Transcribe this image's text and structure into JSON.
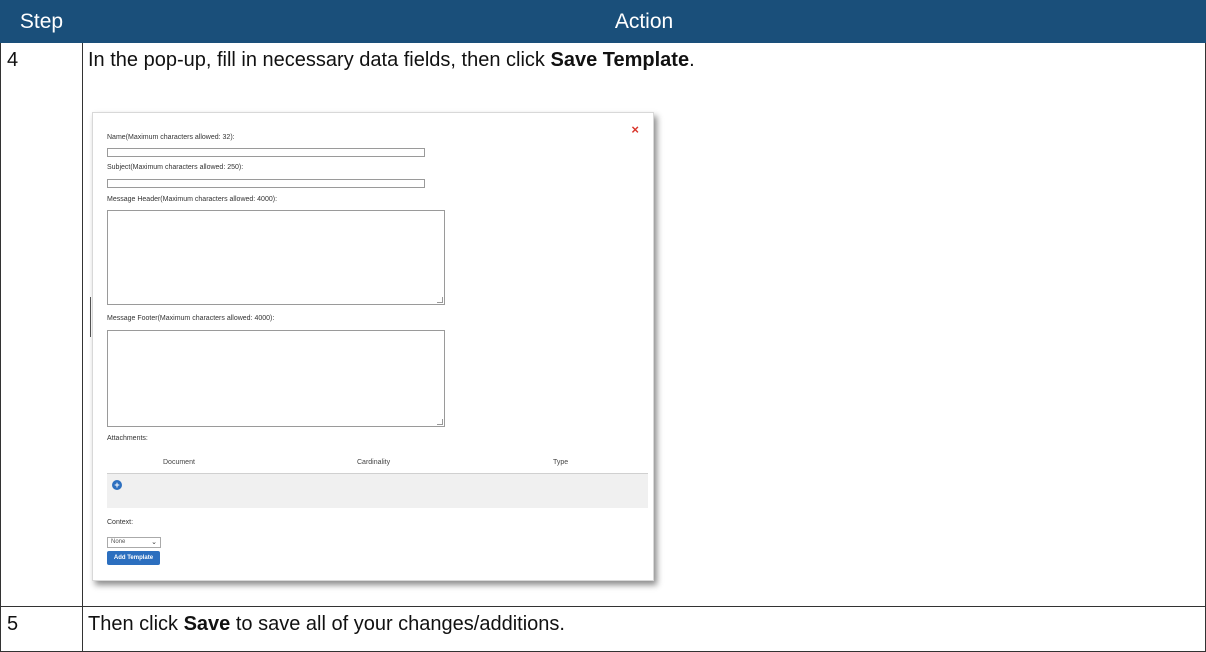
{
  "table": {
    "header_step": "Step",
    "header_action": "Action",
    "rows": [
      {
        "step": "4",
        "text_before": "In the pop-up, fill in necessary data fields, then click ",
        "bold": "Save Template",
        "text_after": "."
      },
      {
        "step": "5",
        "text_before": "Then click ",
        "bold": "Save",
        "text_after": " to save all of your changes/additions."
      }
    ]
  },
  "popup": {
    "close_symbol": "×",
    "name_label": "Name(Maximum characters allowed: 32):",
    "name_value": "",
    "subject_label": "Subject(Maximum characters allowed: 250):",
    "subject_value": "",
    "header_label": "Message Header(Maximum characters allowed: 4000):",
    "header_value": "",
    "footer_label": "Message Footer(Maximum characters allowed: 4000):",
    "footer_value": "",
    "attachments_label": "Attachments:",
    "attachments_columns": [
      "Document",
      "Cardinality",
      "Type"
    ],
    "add_attachment_symbol": "+",
    "context_label": "Context:",
    "context_selected": "None",
    "add_button": "Add Template"
  },
  "colors": {
    "header_bg": "#1a4f7a",
    "accent_blue": "#2c6fbf",
    "close_red": "#d9352b"
  }
}
